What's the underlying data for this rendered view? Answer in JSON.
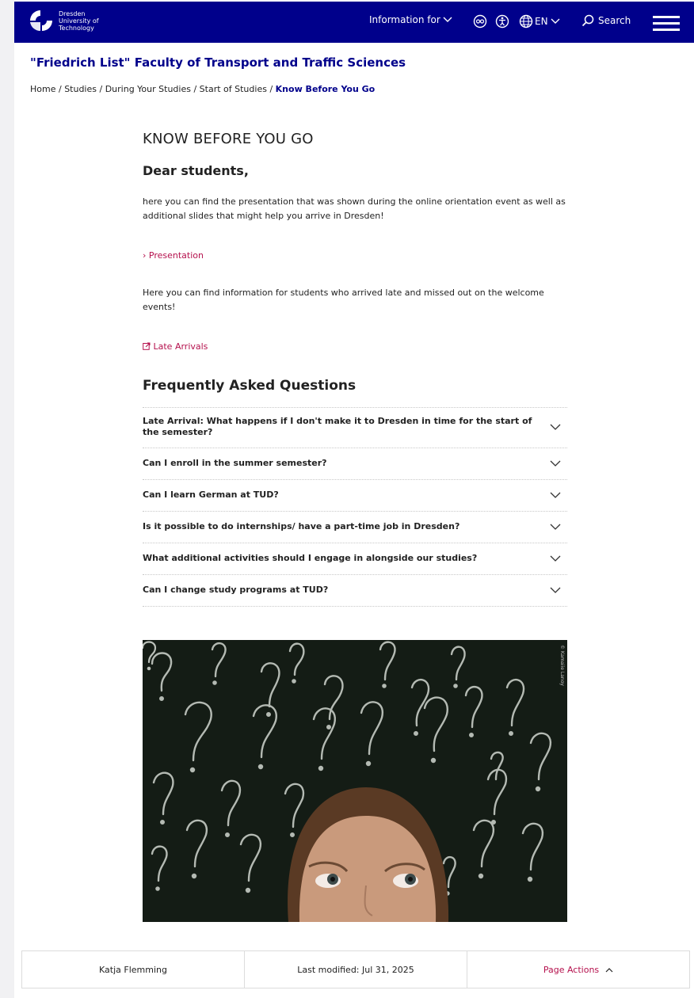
{
  "header": {
    "logo_lines": [
      "Dresden",
      "University of",
      "Technology"
    ],
    "info_label": "Information for",
    "lang_label": "EN",
    "search_label": "Search",
    "brand_color": "#00008b"
  },
  "faculty": "\"Friedrich List\" Faculty of Transport and Traffic Sciences",
  "breadcrumb": {
    "items": [
      "Home",
      "Studies",
      "During Your Studies",
      "Start of Studies"
    ],
    "current": "Know Before You Go",
    "separator": " / "
  },
  "main": {
    "title": "KNOW BEFORE YOU GO",
    "greeting": "Dear students,",
    "para1": "here you can find the presentation that was shown during the online orientation event as well as additional slides that might help you arrive in Dresden!",
    "link1": "Presentation",
    "link1_prefix": "›",
    "para2": "Here you can find information for students who arrived late and missed out on the welcome events!",
    "link2": "Late Arrivals",
    "link_color": "#b5114d"
  },
  "faq": {
    "title": "Frequently Asked Questions",
    "items": [
      "Late Arrival: What happens if I don't make it to Dresden in time for the start of the semester?",
      "Can I enroll in the summer semester?",
      "Can I learn German at TUD?",
      "Is it possible to do internships/ have a part-time job in Dresden?",
      "What additional activities should I engage in alongside our studies?",
      "Can I change study programs at TUD?"
    ]
  },
  "image": {
    "credit": "© Kamaiie Lanoy"
  },
  "footer": {
    "author": "Katja Flemming",
    "modified": "Last modified: Jul 31, 2025",
    "actions": "Page Actions"
  }
}
